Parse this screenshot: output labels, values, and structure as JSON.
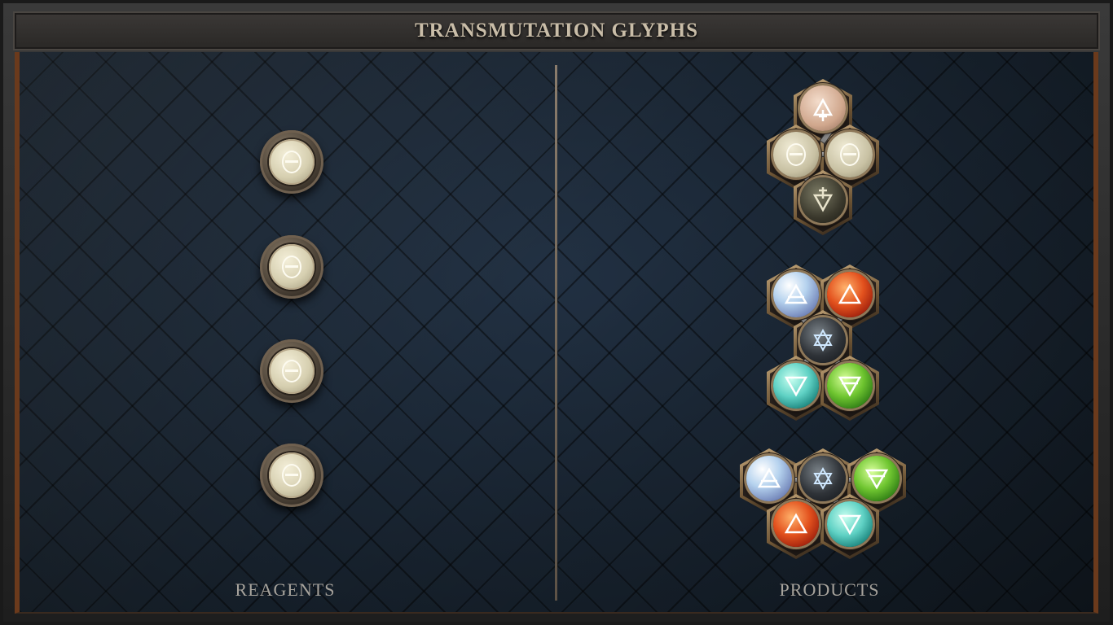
{
  "header": {
    "title": "TRANSMUTATION GLYPHS"
  },
  "panels": {
    "reagents_label": "REAGENTS",
    "products_label": "PRODUCTS"
  },
  "reagents": [
    {
      "element": "salt",
      "icon": "theta-salt-icon"
    },
    {
      "element": "salt",
      "icon": "theta-salt-icon"
    },
    {
      "element": "salt",
      "icon": "theta-salt-icon"
    },
    {
      "element": "salt",
      "icon": "theta-salt-icon"
    }
  ],
  "products": [
    {
      "name": "molecule-1",
      "atoms": [
        "vitae",
        "salt",
        "salt",
        "mors"
      ]
    },
    {
      "name": "molecule-2",
      "atoms": [
        "air",
        "fire",
        "quintessence",
        "water",
        "earth"
      ]
    },
    {
      "name": "molecule-3",
      "atoms": [
        "air",
        "quintessence",
        "earth",
        "fire",
        "water"
      ]
    }
  ],
  "colors": {
    "frame_trim": "#6b3a1c",
    "header_text": "#c9bda8",
    "label_text": "#a7a39c",
    "board": "#17212c"
  }
}
